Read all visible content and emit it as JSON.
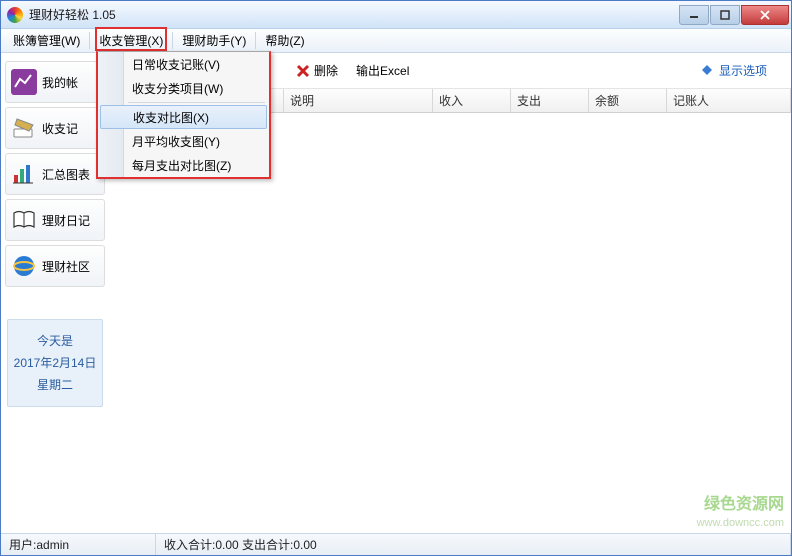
{
  "window": {
    "title": "理财好轻松 1.05"
  },
  "menus": {
    "accounts": "账簿管理(W)",
    "income": "收支管理(X)",
    "assistant": "理财助手(Y)",
    "help": "帮助(Z)"
  },
  "dropdown": {
    "daily": "日常收支记账(V)",
    "category": "收支分类项目(W)",
    "compare": "收支对比图(X)",
    "monthly_avg": "月平均收支图(Y)",
    "monthly_expense": "每月支出对比图(Z)"
  },
  "sidebar": {
    "my_account": "我的帐",
    "income_record": "收支记",
    "summary_chart": "汇总图表",
    "diary": "理财日记",
    "community": "理财社区"
  },
  "datebox": {
    "today_is": "今天是",
    "date": "2017年2月14日",
    "weekday": "星期二"
  },
  "toolbar": {
    "delete": "删除",
    "export": "输出Excel",
    "options": "显示选项"
  },
  "grid": {
    "col_desc": "说明",
    "col_income": "收入",
    "col_expense": "支出",
    "col_balance": "余额",
    "col_recorder": "记账人"
  },
  "status": {
    "user_label": "用户: ",
    "user": "admin",
    "totals": "收入合计:0.00 支出合计:0.00"
  },
  "watermark": {
    "line1": "绿色资源网",
    "line2": "www.downcc.com"
  }
}
